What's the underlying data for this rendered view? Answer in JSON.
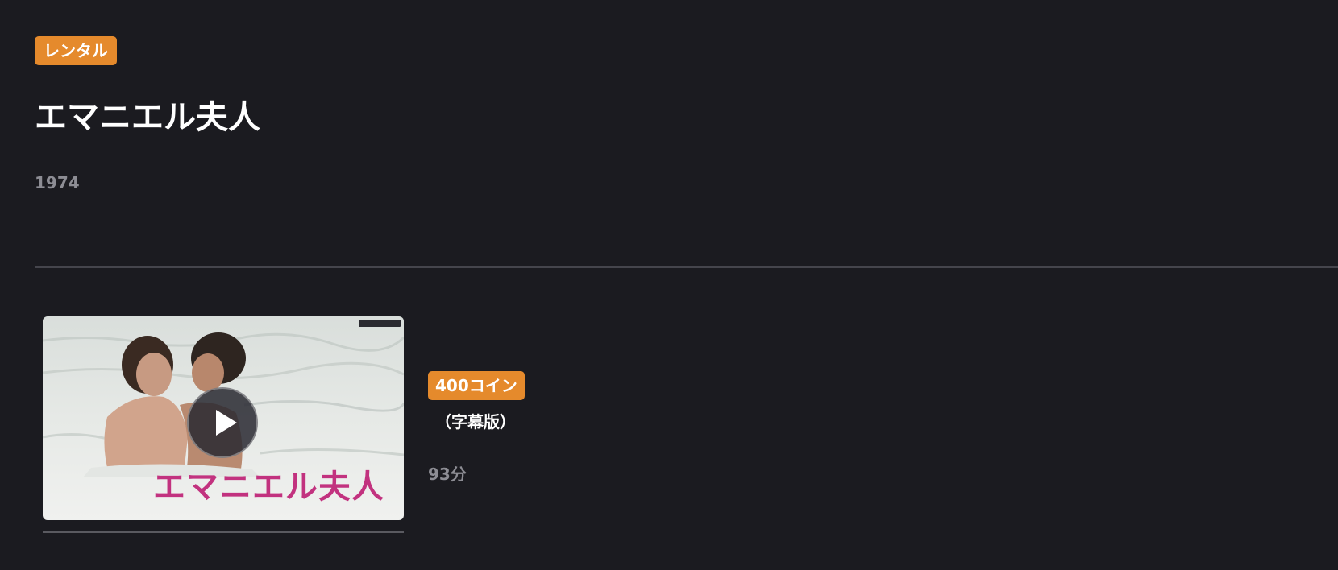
{
  "header": {
    "badge_label": "レンタル",
    "title": "エマニエル夫人",
    "year": "1974"
  },
  "episode": {
    "thumbnail_title": "エマニエル夫人",
    "price_label": "400コイン",
    "version_label": "（字幕版）",
    "duration": "93分",
    "progress": 0
  },
  "colors": {
    "background": "#1b1b20",
    "accent": "#e58a2c",
    "thumbnail_title": "#c2327f"
  },
  "icons": {
    "play": "play-icon",
    "studio": "studio-logo"
  }
}
